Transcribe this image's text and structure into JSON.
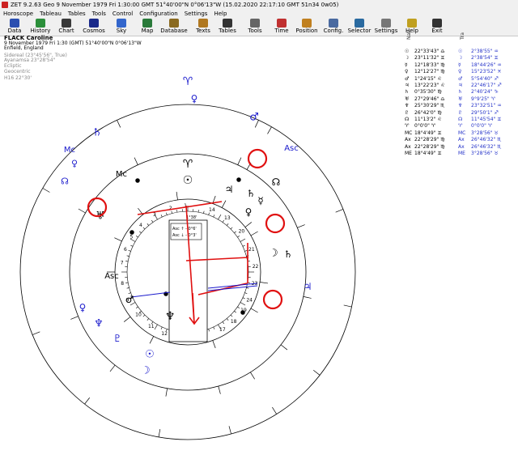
{
  "window": {
    "title": "ZET 9.2.63 Geo   9 November 1979  Fri   1:30:00 GMT 51°40'00\"N  0°06'13\"W   (15.02.2020  22:17:10 GMT 51n34 0w05)"
  },
  "menu": [
    "Horoscope",
    "Tableau",
    "Tables",
    "Tools",
    "Control",
    "Configuration",
    "Settings",
    "Help"
  ],
  "toolbar": [
    {
      "label": "Data",
      "icon": "data-icon",
      "color": "#2b4fb0"
    },
    {
      "label": "History",
      "icon": "history-icon",
      "color": "#2b8f3a"
    },
    {
      "label": "Chart",
      "icon": "chart-icon",
      "color": "#3a3a3a"
    },
    {
      "label": "Cosmos",
      "icon": "cosmos-icon",
      "color": "#1a2a8a"
    },
    {
      "label": "Sky",
      "icon": "sky-icon",
      "color": "#3366cc"
    },
    {
      "label": "Map",
      "icon": "map-icon",
      "color": "#2a7a3a"
    },
    {
      "label": "Database",
      "icon": "database-icon",
      "color": "#8a6a20"
    },
    {
      "label": "Texts",
      "icon": "texts-icon",
      "color": "#b07820"
    },
    {
      "label": "Tables",
      "icon": "tables-icon",
      "color": "#333333"
    },
    {
      "label": "Tools",
      "icon": "tools-icon",
      "color": "#666666"
    },
    {
      "label": "Time",
      "icon": "time-icon",
      "color": "#c03030"
    },
    {
      "label": "Position",
      "icon": "position-icon",
      "color": "#c08020"
    },
    {
      "label": "Config.",
      "icon": "config-icon",
      "color": "#4a6aa0"
    },
    {
      "label": "Selector",
      "icon": "selector-icon",
      "color": "#2a6aa0"
    },
    {
      "label": "Settings",
      "icon": "settings-icon",
      "color": "#777777"
    },
    {
      "label": "Help",
      "icon": "help-icon",
      "color": "#c0a020"
    },
    {
      "label": "Exit",
      "icon": "exit-icon",
      "color": "#333333"
    }
  ],
  "chart_info": {
    "name": "FLACK Caroline",
    "date_line": "9 November 1979  Fri   1:30 (GMT) 51°40'00\"N  0°06'13\"W",
    "place": "Enfield, England",
    "zodiac": "Sidereal (23°45'56\", True)",
    "ayanamsa": "Ayanamsa 23°28'54\"",
    "coords": "Ecliptic",
    "centric": "Geocentric",
    "house_system": "H16  22°30'"
  },
  "table": {
    "header_nat": "Nat",
    "header_tra": "Tra",
    "rows": [
      {
        "g": "☉",
        "nat": "22°33'43\"  ♎",
        "tg": "☉",
        "tra": "2°38'55\"  ♒"
      },
      {
        "g": "☽",
        "nat": "23°11'32\"  ♊",
        "tg": "☽",
        "tra": "2°38'54\"  ♊"
      },
      {
        "g": "☿",
        "nat": "12°18'33\"  ♍",
        "tg": "☿",
        "tra": "18°44'26\"  ♒"
      },
      {
        "g": "♀",
        "nat": "12°12'27\"  ♍",
        "tg": "♀",
        "tra": "15°23'52\"  ♓"
      },
      {
        "g": "♂",
        "nat": "1°24'15\"  ♌",
        "tg": "♂",
        "tra": "5°54'40\"  ♐"
      },
      {
        "g": "♃",
        "nat": "13°22'23\"  ♌",
        "tg": "♃",
        "tra": "22°46'17\"  ♐"
      },
      {
        "g": "♄",
        "nat": "0°35'30\"  ♍",
        "tg": "♄",
        "tra": "2°40'24\"  ♑"
      },
      {
        "g": "♅",
        "nat": "27°29'46\"  ♎",
        "tg": "♅",
        "tra": "9°9'25\"  ♈"
      },
      {
        "g": "♆",
        "nat": "25°30'29\"  ♏",
        "tg": "♆",
        "tra": "23°32'51\"  ♒"
      },
      {
        "g": "♇",
        "nat": "26°42'0\"  ♍",
        "tg": "♇",
        "tra": "29°50'1\"  ♐"
      },
      {
        "g": "☊",
        "nat": "11°13'2\"  ♌",
        "tg": "☊",
        "tra": "11°45'54\"  ♊"
      },
      {
        "g": "♈",
        "nat": "0°0'0\"  ♈",
        "tg": "♈",
        "tra": "0°0'0\"  ♈"
      },
      {
        "g": "MC",
        "nat": "18°4'49\"  ♊",
        "tg": "MC",
        "tra": "3°28'56\"  ♉"
      },
      {
        "g": "Ax",
        "nat": "22°28'29\"  ♍",
        "tg": "Ax",
        "tra": "26°46'32\"  ♏"
      },
      {
        "g": "Ax",
        "nat": "22°28'29\"  ♍",
        "tg": "Ax",
        "tra": "26°46'32\"  ♏"
      },
      {
        "g": "ME",
        "nat": "18°4'49\"  ♊",
        "tg": "ME",
        "tra": "3°28'56\"  ♉"
      }
    ]
  },
  "wheel": {
    "outer_labels": {
      "mc": "Mc",
      "asc": "Asc",
      "transit_mc": "Mc",
      "transit_asc": "Asc"
    },
    "house_numbers": [
      "1",
      "2",
      "3",
      "4",
      "5",
      "6",
      "7",
      "8",
      "9",
      "10",
      "11",
      "12",
      "13",
      "14",
      "15",
      "16",
      "17",
      "18",
      "19",
      "20",
      "21",
      "22",
      "23",
      "24"
    ],
    "center_label": "1°38'",
    "aspect_box": [
      "Asc ↑ - 0°6'",
      "Asc ↓ - 0°3'"
    ],
    "colors": {
      "natal": "#000000",
      "transit": "#1a1acc",
      "highlight": "#e01010"
    }
  }
}
